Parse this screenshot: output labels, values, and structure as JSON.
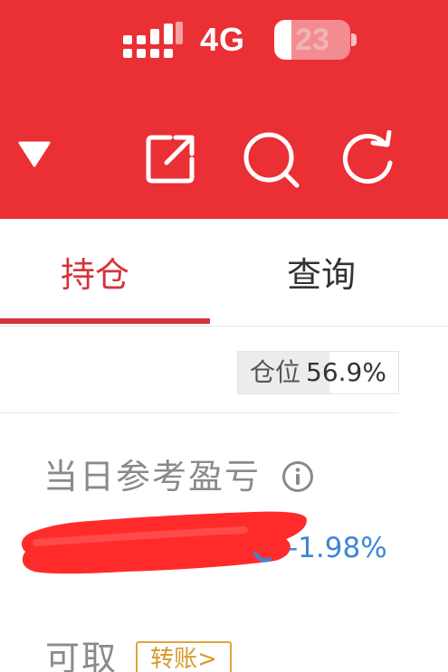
{
  "status_bar": {
    "network": "4G",
    "battery_level": "23",
    "battery_fraction": 0.23,
    "signal_icon": "signal-bars-icon",
    "battery_icon": "battery-icon"
  },
  "toolbar": {
    "icons": [
      "caret-down-icon",
      "share-icon",
      "search-icon",
      "refresh-icon"
    ]
  },
  "tabs": [
    {
      "label": "持仓",
      "active": true
    },
    {
      "label": "查询",
      "active": false
    }
  ],
  "position_ratio": {
    "label": "仓位",
    "value": "56.9%",
    "fraction": 0.569
  },
  "daily_pnl": {
    "label": "当日参考盈亏",
    "info_icon": "info-icon",
    "percent": "-1.98%"
  },
  "withdrawable": {
    "label": "可取",
    "transfer_label": "转账"
  },
  "colors": {
    "header_bg": "#ea2f35",
    "accent_red": "#d5343a",
    "loss_blue": "#3d86d6",
    "transfer_gold": "#d9982a"
  }
}
